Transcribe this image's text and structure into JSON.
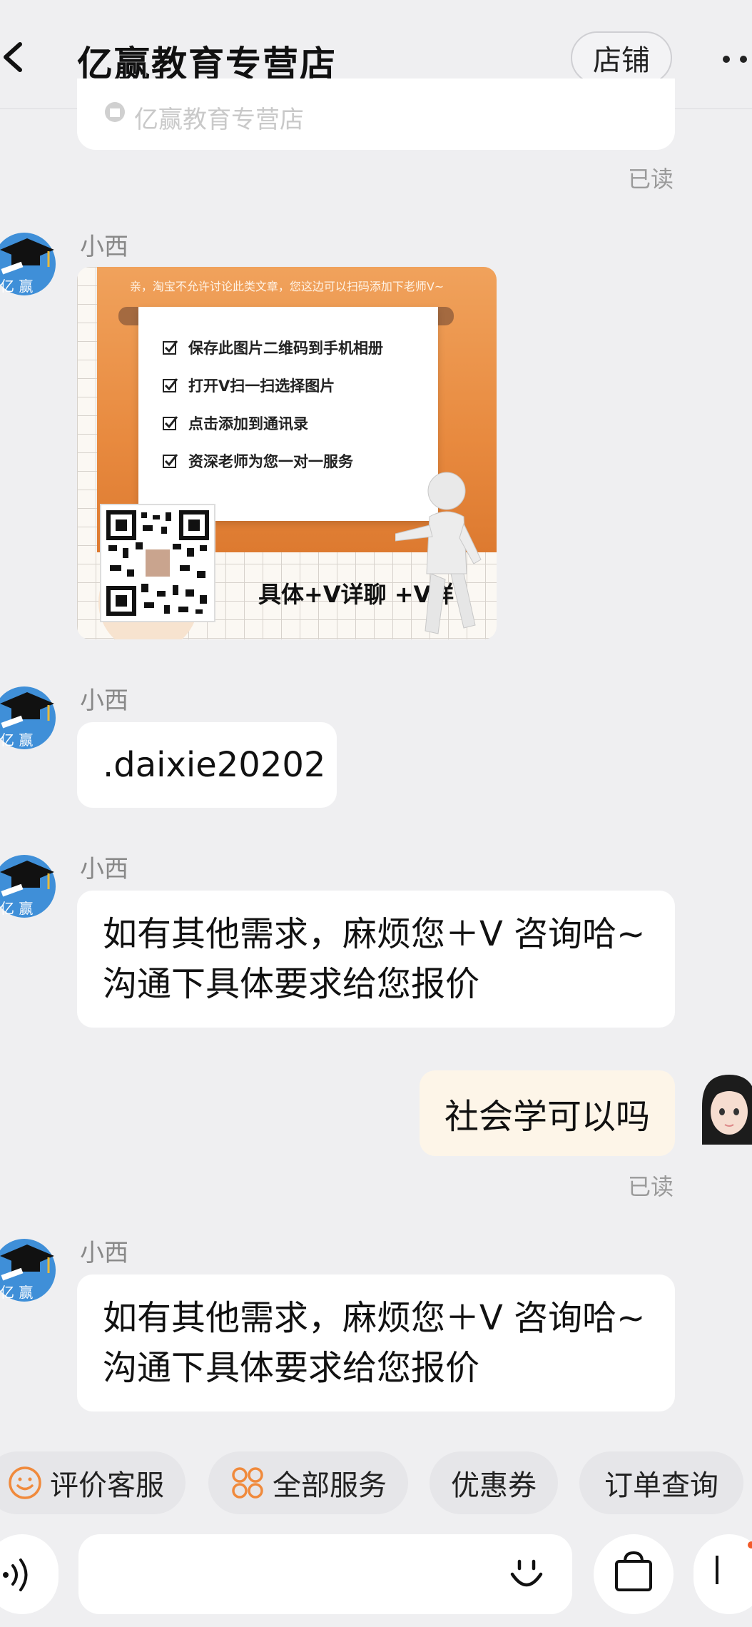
{
  "header": {
    "title": "亿赢教育专营店",
    "shop_button": "店铺"
  },
  "top_card": {
    "shop_name": "亿赢教育专营店"
  },
  "avatar_text": "亿赢",
  "messages": [
    {
      "sender": "小西",
      "type": "image",
      "poster": {
        "notice": "亲，淘宝不允许讨论此类文章，您这边可以扫码添加下老师V~",
        "steps": [
          "保存此图片二维码到手机相册",
          "打开V扫一扫选择图片",
          "点击添加到通讯录",
          "资深老师为您一对一服务"
        ],
        "caption": "具体+V详聊 +V详"
      }
    },
    {
      "sender": "小西",
      "text": ".daixie20202"
    },
    {
      "sender": "小西",
      "lines": [
        "如有其他需求，麻烦您＋V 咨询哈~",
        "沟通下具体要求给您报价"
      ]
    },
    {
      "sender": "me",
      "text": "社会学可以吗"
    },
    {
      "sender": "小西",
      "lines": [
        "如有其他需求，麻烦您＋V 咨询哈~",
        "沟通下具体要求给您报价"
      ]
    }
  ],
  "read_label": "已读",
  "quick_actions": [
    {
      "label": "评价客服",
      "icon": "smile-face-icon"
    },
    {
      "label": "全部服务",
      "icon": "services-grid-icon"
    },
    {
      "label": "优惠券"
    },
    {
      "label": "订单查询"
    }
  ],
  "input": {
    "placeholder": ""
  },
  "colors": {
    "accent_orange": "#f08a3c",
    "mine_bubble": "#fdf5e8",
    "background": "#efeff1"
  }
}
